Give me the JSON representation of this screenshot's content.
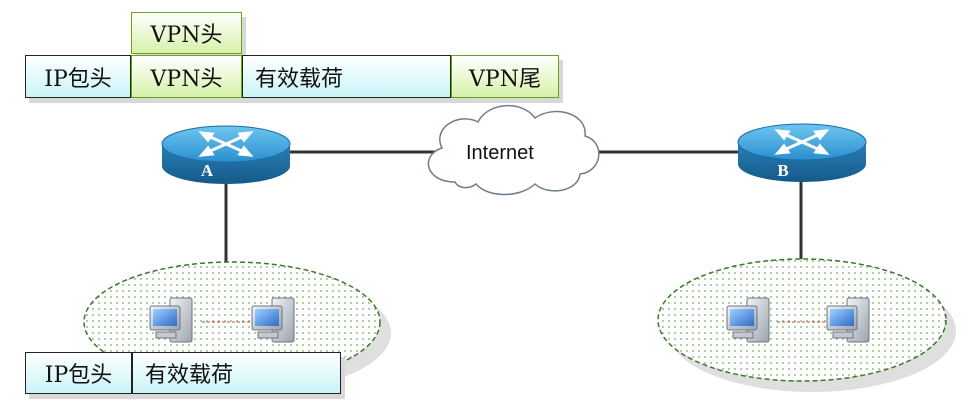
{
  "top_packet": {
    "vpn_header_stacked": "VPN头",
    "ip_header": "IP包头",
    "vpn_header": "VPN头",
    "payload": "有效载荷",
    "vpn_trailer": "VPN尾"
  },
  "bottom_packet": {
    "ip_header": "IP包头",
    "payload": "有效载荷"
  },
  "network": {
    "router_a": "A",
    "router_b": "B",
    "internet": "Internet"
  },
  "colors": {
    "router_blue": "#2e86c1",
    "link": "#333333",
    "lan_border": "#3a7a2a",
    "lan_dots": "#6fb05f",
    "cloud_border": "#6e7e8e"
  }
}
